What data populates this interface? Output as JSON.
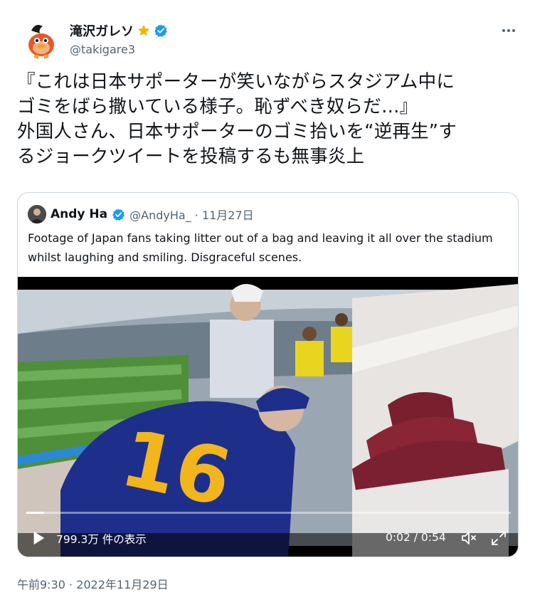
{
  "author": {
    "display_name": "滝沢ガレソ",
    "handle": "@takigare3",
    "avatar_icon": "duck-mascot-avatar-icon",
    "badge_icons": [
      "star-icon",
      "verified-badge-icon"
    ]
  },
  "tweet": {
    "lines": [
      "『これは日本サポーターが笑いながらスタジアム中に",
      "ゴミをばら撒いている様子。恥ずべき奴らだ…』",
      "外国人さん、日本サポーターのゴミ拾いを“逆再生”す",
      "るジョークツイートを投稿するも無事炎上"
    ],
    "timestamp": "午前9:30 · 2022年11月29日"
  },
  "quoted_tweet": {
    "display_name": "Andy Ha",
    "handle_and_date": "@AndyHa_ · 11月27日",
    "text": "Footage of Japan fans taking litter out of a bag and leaving it all over the stadium whilst laughing and smiling. Disgraceful scenes.",
    "video": {
      "views_label": "799.3万 件の表示",
      "timecode": "0:02 / 0:54",
      "progress": 0.037,
      "controls": [
        "play-icon",
        "mute-icon",
        "fullscreen-icon"
      ]
    }
  },
  "colors": {
    "text_primary": "#0f1419",
    "text_secondary": "#536471",
    "verified_blue": "#1d9bf0",
    "star_gold": "#f4b400",
    "border": "#cfd9de"
  }
}
